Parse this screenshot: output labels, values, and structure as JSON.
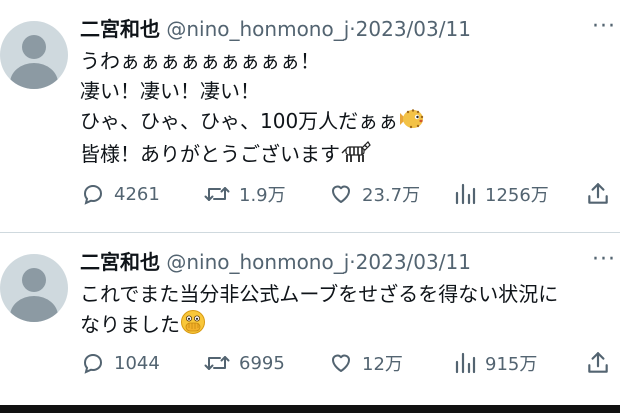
{
  "tweets": [
    {
      "author_name": "二宮和也",
      "handle": "@nino_honmono_j",
      "separator": "·",
      "date": "2023/03/11",
      "lines": [
        "うわぁぁぁぁぁぁぁぁぁ！",
        "凄い！凄い！凄い！",
        "ひゃ、ひゃ、ひゃ、100万人だぁぁ",
        "皆様！ありがとうございます"
      ],
      "emojis": [
        "blowfish-emoji",
        "zebra-emoji"
      ],
      "reply_count": "4261",
      "retweet_count": "1.9万",
      "like_count": "23.7万",
      "view_count": "1256万"
    },
    {
      "author_name": "二宮和也",
      "handle": "@nino_honmono_j",
      "separator": "·",
      "date": "2023/03/11",
      "lines": [
        "これでまた当分非公式ムーブをせざるを得ない状況に",
        "なりました"
      ],
      "emojis": [
        "face-with-open-eyes-and-hand-over-mouth-emoji"
      ],
      "reply_count": "1044",
      "retweet_count": "6995",
      "like_count": "12万",
      "view_count": "915万"
    }
  ],
  "icons": [
    "avatar-placeholder",
    "more-icon",
    "reply-icon",
    "retweet-icon",
    "like-icon",
    "views-icon",
    "share-icon"
  ],
  "colors": {
    "text": "#0f1419",
    "secondary": "#536471",
    "divider": "#cfd9de",
    "avatar_bg": "#cfd9de"
  }
}
